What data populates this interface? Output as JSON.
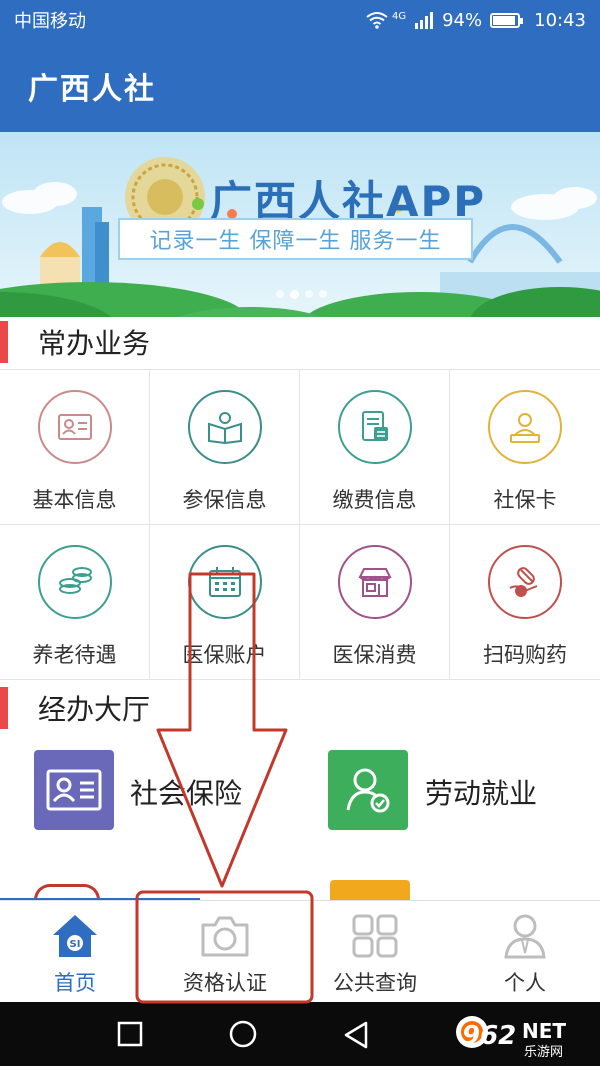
{
  "status": {
    "carrier": "中国移动",
    "network": "4G",
    "battery": "94%",
    "time": "10:43"
  },
  "app": {
    "title": "广西人社"
  },
  "banner": {
    "title": "广西人社APP",
    "slogan": "记录一生  保障一生  服务一生",
    "slides": 4,
    "active_slide": 2
  },
  "common": {
    "header": "常办业务",
    "items": [
      {
        "label": "基本信息",
        "icon": "id-card-icon",
        "color": "#c98a8a"
      },
      {
        "label": "参保信息",
        "icon": "open-book-icon",
        "color": "#3a8f8a"
      },
      {
        "label": "缴费信息",
        "icon": "document-icon",
        "color": "#3d9f8f"
      },
      {
        "label": "社保卡",
        "icon": "card-user-icon",
        "color": "#e0b33a"
      },
      {
        "label": "养老待遇",
        "icon": "coins-icon",
        "color": "#3d9f8f"
      },
      {
        "label": "医保账户",
        "icon": "calendar-icon",
        "color": "#3a8f8a"
      },
      {
        "label": "医保消费",
        "icon": "store-icon",
        "color": "#a0538a"
      },
      {
        "label": "扫码购药",
        "icon": "medicine-hand-icon",
        "color": "#c0504d"
      }
    ]
  },
  "hall": {
    "header": "经办大厅",
    "items": [
      {
        "label": "社会保险",
        "icon": "id-card-icon",
        "color": "#6a68b8"
      },
      {
        "label": "劳动就业",
        "icon": "user-check-icon",
        "color": "#3cae5c"
      }
    ]
  },
  "nav": {
    "items": [
      {
        "label": "首页",
        "icon": "home-icon"
      },
      {
        "label": "资格认证",
        "icon": "camera-icon"
      },
      {
        "label": "公共查询",
        "icon": "grid-icon"
      },
      {
        "label": "个人",
        "icon": "person-icon"
      }
    ],
    "active": 0
  },
  "watermark": {
    "brand": "962",
    "suffix": "NET",
    "sub": "乐游网"
  },
  "colors": {
    "primary": "#2f6dc0",
    "accent_red": "#e84a4a",
    "annotation": "#c0392b"
  }
}
